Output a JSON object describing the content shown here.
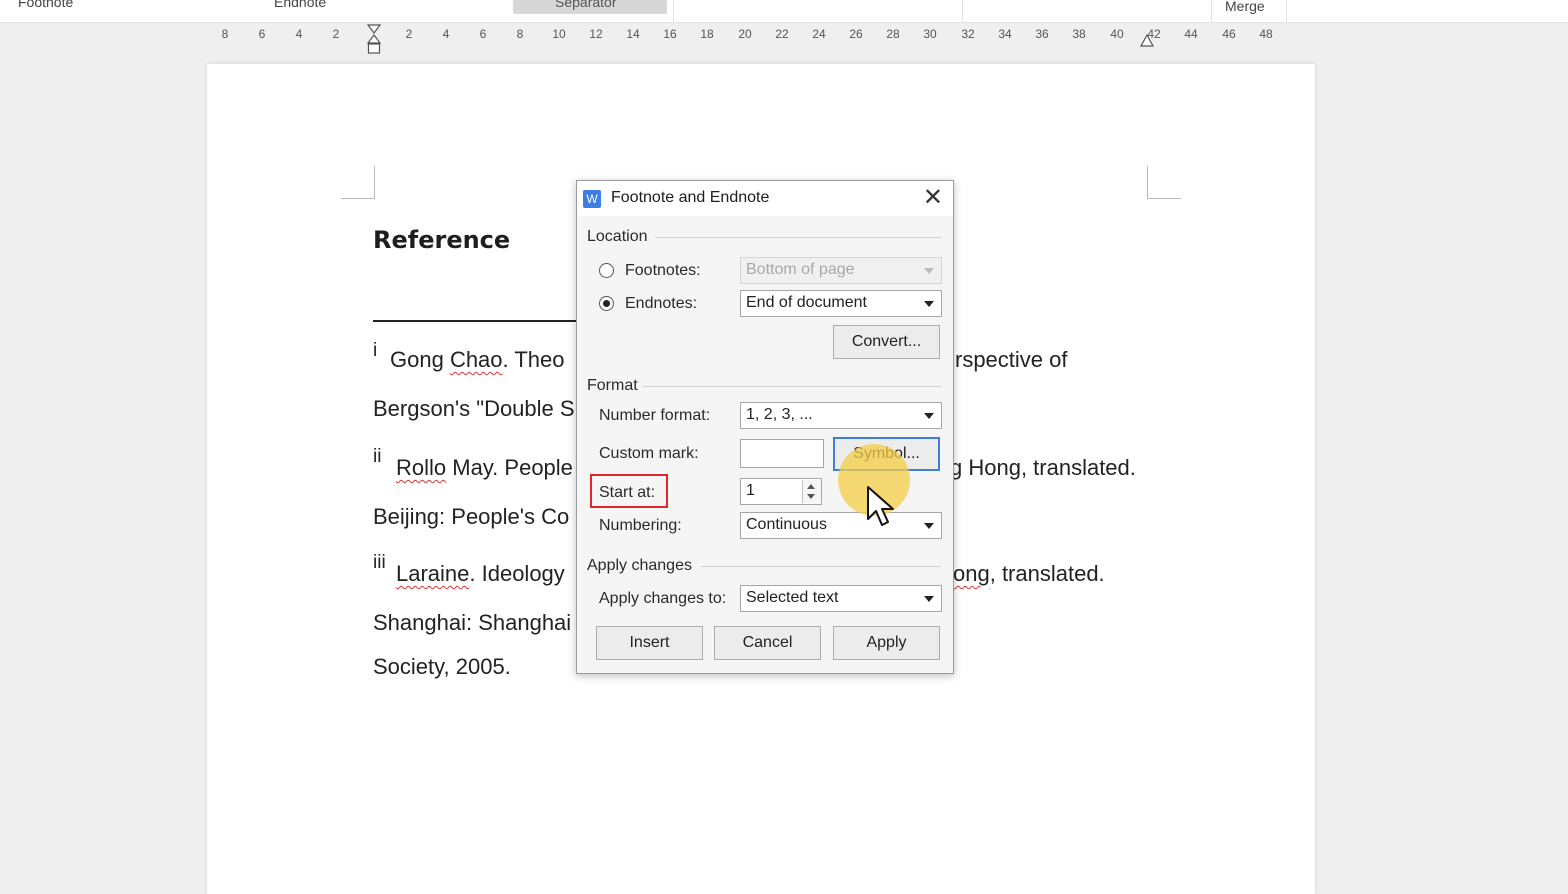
{
  "ribbon": {
    "footnote": "Footnote",
    "endnote": "Endnote",
    "separator": "Separator",
    "merge": "Merge"
  },
  "ruler": {
    "left": [
      "8",
      "6",
      "4",
      "2"
    ],
    "right": [
      "2",
      "4",
      "6",
      "8",
      "10",
      "12",
      "14",
      "16",
      "18",
      "20",
      "22",
      "24",
      "26",
      "28",
      "30",
      "32",
      "34",
      "36",
      "38",
      "40",
      "42",
      "44",
      "46",
      "48"
    ]
  },
  "document": {
    "heading": "Reference",
    "note1_mark": "i",
    "note1_line1_a": "Gong ",
    "note1_line1_b": "Chao",
    "note1_line1_c": ". Theo",
    "note1_line1_right": "rspective of",
    "note1_line2": "Bergson's \"Double S",
    "note2_mark": "ii",
    "note2_line1_a": "Rollo",
    "note2_line1_b": " May. People",
    "note2_line1_right": "g Hong, translated.",
    "note2_line2": "Beijing: People's Co",
    "note3_mark": "iii",
    "note3_line1_a": "Laraine",
    "note3_line1_b": ". Ideology",
    "note3_line1_right_a": "ong",
    "note3_line1_right_b": ", translated.",
    "note3_line2": "Shanghai: Shanghai",
    "note3_line3": "Society, 2005."
  },
  "dialog": {
    "title": "Footnote and Endnote",
    "location_label": "Location",
    "footnotes_label": "Footnotes:",
    "footnotes_value": "Bottom of page",
    "endnotes_label": "Endnotes:",
    "endnotes_value": "End of document",
    "convert_label": "Convert...",
    "format_label": "Format",
    "number_format_label": "Number format:",
    "number_format_value": "1, 2, 3, ...",
    "custom_mark_label": "Custom mark:",
    "custom_mark_value": "",
    "symbol_label": "Symbol...",
    "start_at_label": "Start at:",
    "start_at_value": "1",
    "numbering_label": "Numbering:",
    "numbering_value": "Continuous",
    "apply_changes_label": "Apply changes",
    "apply_changes_to_label": "Apply changes to:",
    "apply_changes_to_value": "Selected text",
    "insert_label": "Insert",
    "cancel_label": "Cancel",
    "apply_label": "Apply",
    "selected_location": "endnotes"
  },
  "colors": {
    "highlight_box": "#e0262c",
    "focus_border": "#3d7fd8",
    "cursor_halo": "#f6cd46",
    "app_icon": "#3c7ee6"
  }
}
